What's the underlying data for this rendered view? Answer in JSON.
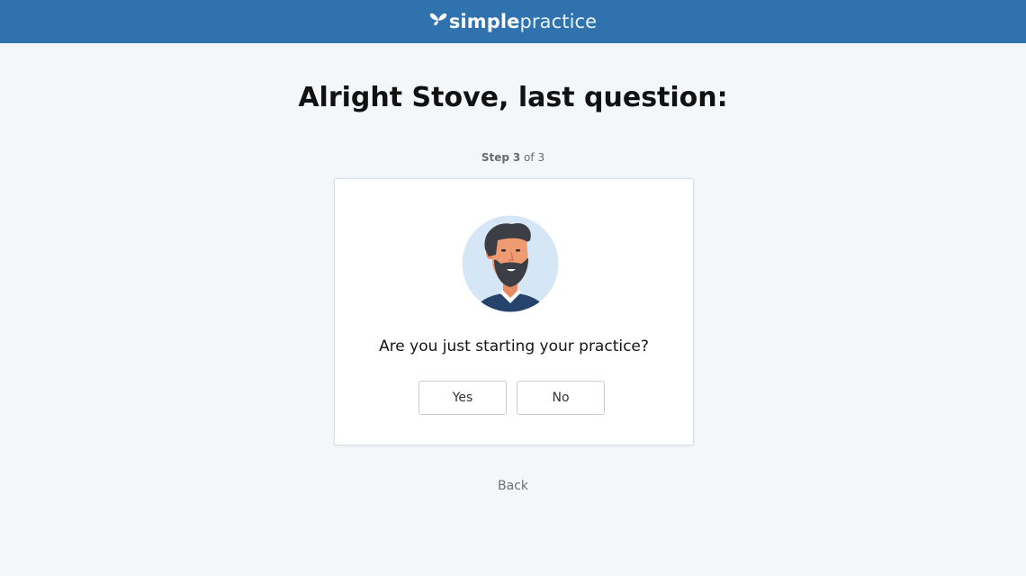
{
  "header": {
    "brand_bold": "simple",
    "brand_light": "practice",
    "brand_color": "#2f72ae"
  },
  "main": {
    "heading": "Alright Stove, last question:",
    "step": {
      "prefix": "Step",
      "current": "3",
      "separator": "of",
      "total": "3"
    }
  },
  "card": {
    "avatar_icon": "avatar-bearded-man-icon",
    "question": "Are you just starting your practice?",
    "yes_label": "Yes",
    "no_label": "No"
  },
  "footer": {
    "back_label": "Back"
  }
}
